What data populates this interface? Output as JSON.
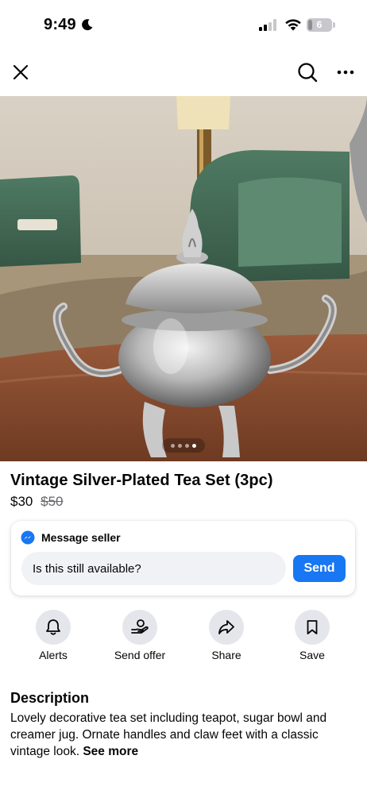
{
  "status_bar": {
    "time": "9:49",
    "battery_level": "6"
  },
  "nav": {
    "icons": [
      "close-icon",
      "search-icon",
      "more-icon"
    ]
  },
  "gallery": {
    "page_count": 4,
    "active_page": 4
  },
  "listing": {
    "title": "Vintage Silver-Plated Tea Set (3pc)",
    "price": "$30",
    "original_price": "$50"
  },
  "message": {
    "header": "Message seller",
    "input_value": "Is this still available?",
    "send_label": "Send"
  },
  "actions": [
    {
      "label": "Alerts",
      "icon": "bell-icon"
    },
    {
      "label": "Send offer",
      "icon": "offer-icon"
    },
    {
      "label": "Share",
      "icon": "share-icon"
    },
    {
      "label": "Save",
      "icon": "bookmark-icon"
    }
  ],
  "description": {
    "heading": "Description",
    "text": "Lovely decorative tea set including teapot, sugar bowl and creamer jug. Ornate handles and claw feet with a classic vintage look.",
    "see_more": "See more"
  },
  "colors": {
    "accent": "#1877f2",
    "chip_bg": "#e4e6eb",
    "muted_text": "#65676b"
  }
}
